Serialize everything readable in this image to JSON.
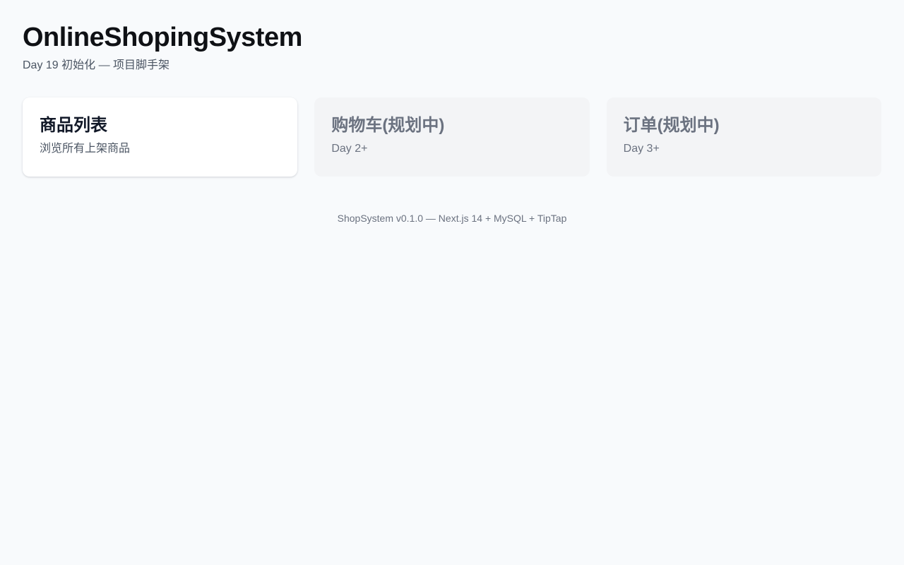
{
  "header": {
    "title": "OnlineShopingSystem",
    "subtitle": "Day 19 初始化 — 项目脚手架"
  },
  "cards": [
    {
      "title": "商品列表",
      "description": "浏览所有上架商品",
      "state": "active"
    },
    {
      "title": "购物车(规划中)",
      "description": "Day 2+",
      "state": "planned"
    },
    {
      "title": "订单(规划中)",
      "description": "Day 3+",
      "state": "planned"
    }
  ],
  "footer": {
    "text": "ShopSystem v0.1.0 — Next.js 14 + MySQL + TipTap"
  },
  "colors": {
    "background": "#f8fafc",
    "card_active": "#ffffff",
    "card_planned": "#f3f4f6",
    "text_primary": "#111827",
    "text_muted": "#6b7280"
  }
}
